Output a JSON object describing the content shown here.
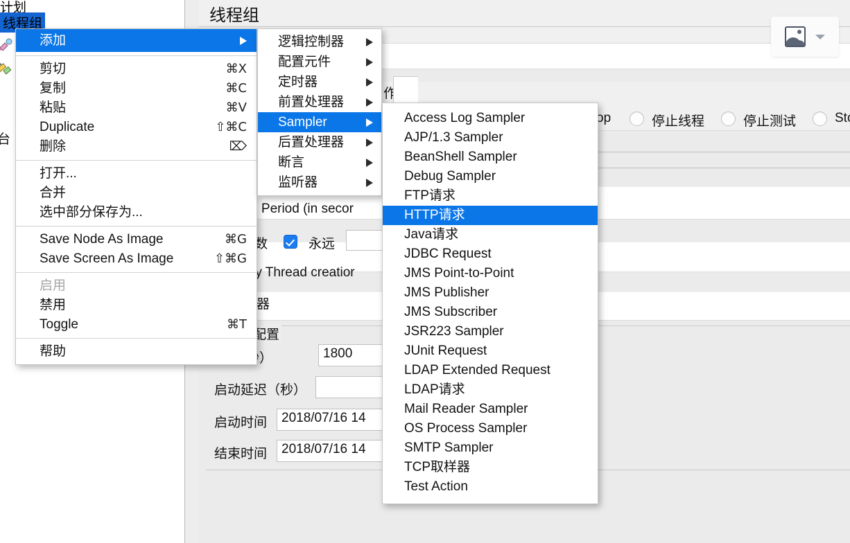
{
  "app": {
    "tree": {
      "nodes": [
        {
          "label": "计划",
          "selected": false
        },
        {
          "label": "线程组",
          "selected": true
        }
      ],
      "console_label": "台"
    },
    "content": {
      "title": "线程组",
      "action_fragment": "作",
      "rampup_label": "-Up Period (in secor",
      "loop_count_label": "数",
      "forever_label": "永远",
      "delay_label": "elay Thread creatior",
      "scheduler_label": "度器",
      "scheduler_group_label": "配置",
      "duration_label": "间（秒）",
      "duration_value": "1800",
      "startup_delay_label": "启动延迟（秒）",
      "startup_delay_value": "",
      "start_time_label": "启动时间",
      "start_time_value": "2018/07/16 14",
      "end_time_label": "结束时间",
      "end_time_value": "2018/07/16 14",
      "radios": [
        {
          "label": "op",
          "partial": true
        },
        {
          "label": "停止线程",
          "partial": false
        },
        {
          "label": "停止测试",
          "partial": false
        },
        {
          "label": "Sto",
          "partial": true
        }
      ]
    },
    "image_button": {
      "icon": "image-icon",
      "caret": "chevron-down-icon"
    }
  },
  "menus": {
    "context": {
      "items": [
        {
          "label": "添加",
          "accel": "",
          "submenu": true,
          "selected": true
        },
        {
          "separator": true
        },
        {
          "label": "剪切",
          "accel": "⌘X"
        },
        {
          "label": "复制",
          "accel": "⌘C"
        },
        {
          "label": "粘贴",
          "accel": "⌘V"
        },
        {
          "label": "Duplicate",
          "accel": "⇧⌘C"
        },
        {
          "label": "删除",
          "accel": "⌦"
        },
        {
          "separator": true
        },
        {
          "label": "打开...",
          "accel": ""
        },
        {
          "label": "合并",
          "accel": ""
        },
        {
          "label": "选中部分保存为...",
          "accel": ""
        },
        {
          "separator": true
        },
        {
          "label": "Save Node As Image",
          "accel": "⌘G"
        },
        {
          "label": "Save Screen As Image",
          "accel": "⇧⌘G"
        },
        {
          "separator": true
        },
        {
          "label": "启用",
          "accel": "",
          "disabled": true
        },
        {
          "label": "禁用",
          "accel": ""
        },
        {
          "label": "Toggle",
          "accel": "⌘T"
        },
        {
          "separator": true
        },
        {
          "label": "帮助",
          "accel": ""
        }
      ]
    },
    "add": {
      "items": [
        {
          "label": "逻辑控制器",
          "submenu": true
        },
        {
          "label": "配置元件",
          "submenu": true
        },
        {
          "label": "定时器",
          "submenu": true
        },
        {
          "label": "前置处理器",
          "submenu": true
        },
        {
          "label": "Sampler",
          "submenu": true,
          "selected": true
        },
        {
          "label": "后置处理器",
          "submenu": true
        },
        {
          "label": "断言",
          "submenu": true
        },
        {
          "label": "监听器",
          "submenu": true
        }
      ]
    },
    "sampler": {
      "items": [
        {
          "label": "Access Log Sampler"
        },
        {
          "label": "AJP/1.3 Sampler"
        },
        {
          "label": "BeanShell Sampler"
        },
        {
          "label": "Debug Sampler"
        },
        {
          "label": "FTP请求"
        },
        {
          "label": "HTTP请求",
          "selected": true
        },
        {
          "label": "Java请求"
        },
        {
          "label": "JDBC Request"
        },
        {
          "label": "JMS Point-to-Point"
        },
        {
          "label": "JMS Publisher"
        },
        {
          "label": "JMS Subscriber"
        },
        {
          "label": "JSR223 Sampler"
        },
        {
          "label": "JUnit Request"
        },
        {
          "label": "LDAP Extended Request"
        },
        {
          "label": "LDAP请求"
        },
        {
          "label": "Mail Reader Sampler"
        },
        {
          "label": "OS Process Sampler"
        },
        {
          "label": "SMTP Sampler"
        },
        {
          "label": "TCP取样器"
        },
        {
          "label": "Test Action"
        }
      ]
    }
  },
  "colors": {
    "highlight": "#0a76e8",
    "tree_selection": "#1464d2",
    "checkbox": "#1a7cf0",
    "panel": "#ededed"
  }
}
